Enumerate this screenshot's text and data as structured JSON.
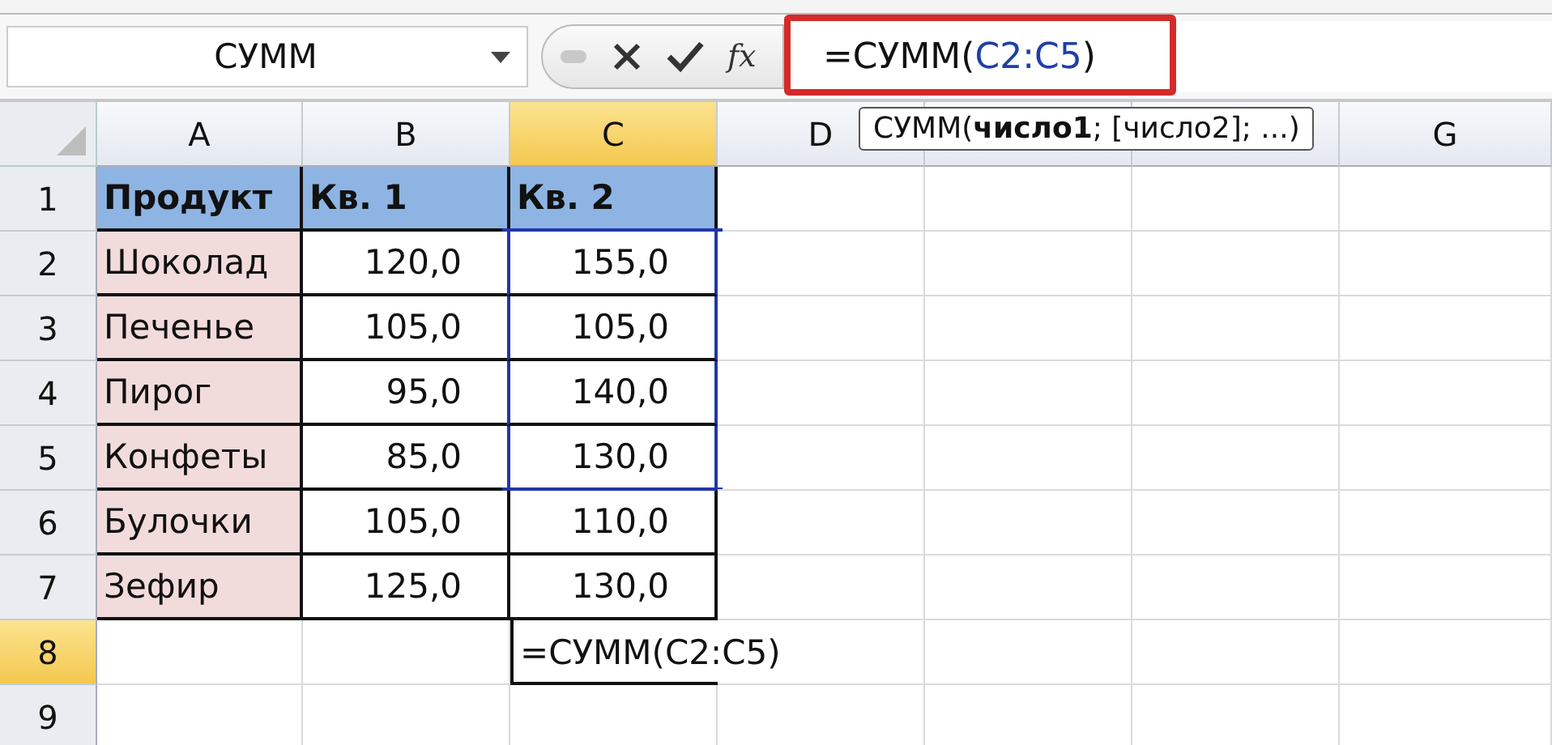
{
  "formula_bar": {
    "name_box": "СУММ",
    "function_button": "fx",
    "formula": {
      "prefix": "=СУММ(",
      "reference": "C2:C5",
      "suffix": ")"
    },
    "highlighted": true
  },
  "tooltip": "СУММ(**число1**; [число2]; ...)",
  "sheet": {
    "columns": [
      {
        "kind": "column",
        "label": "A",
        "selected": false
      },
      {
        "kind": "column",
        "label": "B",
        "selected": false
      },
      {
        "kind": "column",
        "label": "C",
        "selected": true
      },
      {
        "kind": "column",
        "label": "D",
        "selected": false
      },
      {
        "kind": "covered"
      },
      {
        "kind": "covered"
      },
      {
        "kind": "column",
        "label": "G",
        "selected": false
      }
    ],
    "rows": [
      {
        "number": "1",
        "kind": "header",
        "selected": false,
        "in_range": false,
        "cells": [
          "Продукт",
          "Кв. 1",
          "Кв. 2"
        ]
      },
      {
        "number": "2",
        "kind": "data",
        "selected": false,
        "in_range": true,
        "cells": [
          "Шоколад",
          "120,0",
          "155,0"
        ]
      },
      {
        "number": "3",
        "kind": "data",
        "selected": false,
        "in_range": true,
        "cells": [
          "Печенье",
          "105,0",
          "105,0"
        ]
      },
      {
        "number": "4",
        "kind": "data",
        "selected": false,
        "in_range": true,
        "cells": [
          "Пирог",
          "95,0",
          "140,0"
        ]
      },
      {
        "number": "5",
        "kind": "data",
        "selected": false,
        "in_range": true,
        "cells": [
          "Конфеты",
          "85,0",
          "130,0"
        ]
      },
      {
        "number": "6",
        "kind": "data",
        "selected": false,
        "in_range": false,
        "cells": [
          "Булочки",
          "105,0",
          "110,0"
        ]
      },
      {
        "number": "7",
        "kind": "data",
        "selected": false,
        "in_range": false,
        "cells": [
          "Зефир",
          "125,0",
          "130,0"
        ]
      },
      {
        "number": "8",
        "kind": "edit",
        "selected": true,
        "edit_text": "=СУММ(C2:C5)"
      },
      {
        "number": "9",
        "kind": "blank",
        "selected": false
      }
    ]
  }
}
